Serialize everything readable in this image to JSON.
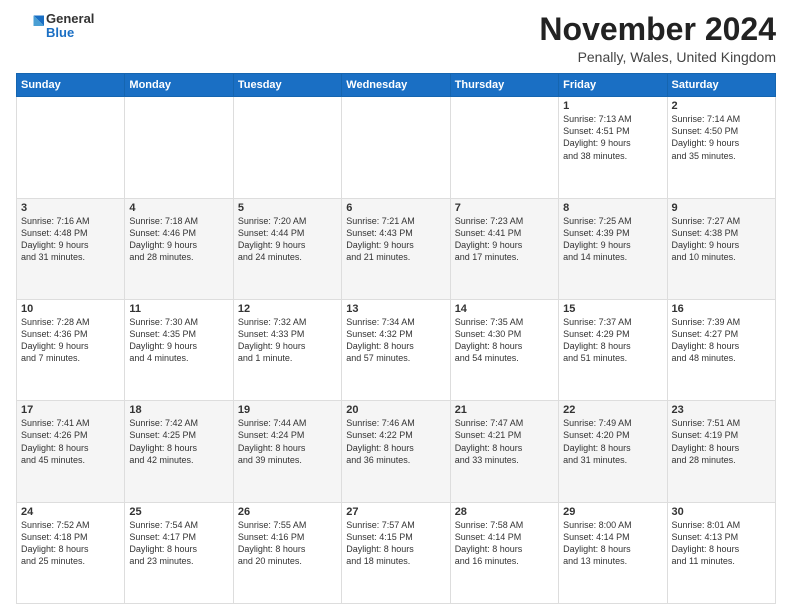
{
  "header": {
    "logo_general": "General",
    "logo_blue": "Blue",
    "month": "November 2024",
    "location": "Penally, Wales, United Kingdom"
  },
  "weekdays": [
    "Sunday",
    "Monday",
    "Tuesday",
    "Wednesday",
    "Thursday",
    "Friday",
    "Saturday"
  ],
  "weeks": [
    [
      {
        "day": "",
        "info": ""
      },
      {
        "day": "",
        "info": ""
      },
      {
        "day": "",
        "info": ""
      },
      {
        "day": "",
        "info": ""
      },
      {
        "day": "",
        "info": ""
      },
      {
        "day": "1",
        "info": "Sunrise: 7:13 AM\nSunset: 4:51 PM\nDaylight: 9 hours\nand 38 minutes."
      },
      {
        "day": "2",
        "info": "Sunrise: 7:14 AM\nSunset: 4:50 PM\nDaylight: 9 hours\nand 35 minutes."
      }
    ],
    [
      {
        "day": "3",
        "info": "Sunrise: 7:16 AM\nSunset: 4:48 PM\nDaylight: 9 hours\nand 31 minutes."
      },
      {
        "day": "4",
        "info": "Sunrise: 7:18 AM\nSunset: 4:46 PM\nDaylight: 9 hours\nand 28 minutes."
      },
      {
        "day": "5",
        "info": "Sunrise: 7:20 AM\nSunset: 4:44 PM\nDaylight: 9 hours\nand 24 minutes."
      },
      {
        "day": "6",
        "info": "Sunrise: 7:21 AM\nSunset: 4:43 PM\nDaylight: 9 hours\nand 21 minutes."
      },
      {
        "day": "7",
        "info": "Sunrise: 7:23 AM\nSunset: 4:41 PM\nDaylight: 9 hours\nand 17 minutes."
      },
      {
        "day": "8",
        "info": "Sunrise: 7:25 AM\nSunset: 4:39 PM\nDaylight: 9 hours\nand 14 minutes."
      },
      {
        "day": "9",
        "info": "Sunrise: 7:27 AM\nSunset: 4:38 PM\nDaylight: 9 hours\nand 10 minutes."
      }
    ],
    [
      {
        "day": "10",
        "info": "Sunrise: 7:28 AM\nSunset: 4:36 PM\nDaylight: 9 hours\nand 7 minutes."
      },
      {
        "day": "11",
        "info": "Sunrise: 7:30 AM\nSunset: 4:35 PM\nDaylight: 9 hours\nand 4 minutes."
      },
      {
        "day": "12",
        "info": "Sunrise: 7:32 AM\nSunset: 4:33 PM\nDaylight: 9 hours\nand 1 minute."
      },
      {
        "day": "13",
        "info": "Sunrise: 7:34 AM\nSunset: 4:32 PM\nDaylight: 8 hours\nand 57 minutes."
      },
      {
        "day": "14",
        "info": "Sunrise: 7:35 AM\nSunset: 4:30 PM\nDaylight: 8 hours\nand 54 minutes."
      },
      {
        "day": "15",
        "info": "Sunrise: 7:37 AM\nSunset: 4:29 PM\nDaylight: 8 hours\nand 51 minutes."
      },
      {
        "day": "16",
        "info": "Sunrise: 7:39 AM\nSunset: 4:27 PM\nDaylight: 8 hours\nand 48 minutes."
      }
    ],
    [
      {
        "day": "17",
        "info": "Sunrise: 7:41 AM\nSunset: 4:26 PM\nDaylight: 8 hours\nand 45 minutes."
      },
      {
        "day": "18",
        "info": "Sunrise: 7:42 AM\nSunset: 4:25 PM\nDaylight: 8 hours\nand 42 minutes."
      },
      {
        "day": "19",
        "info": "Sunrise: 7:44 AM\nSunset: 4:24 PM\nDaylight: 8 hours\nand 39 minutes."
      },
      {
        "day": "20",
        "info": "Sunrise: 7:46 AM\nSunset: 4:22 PM\nDaylight: 8 hours\nand 36 minutes."
      },
      {
        "day": "21",
        "info": "Sunrise: 7:47 AM\nSunset: 4:21 PM\nDaylight: 8 hours\nand 33 minutes."
      },
      {
        "day": "22",
        "info": "Sunrise: 7:49 AM\nSunset: 4:20 PM\nDaylight: 8 hours\nand 31 minutes."
      },
      {
        "day": "23",
        "info": "Sunrise: 7:51 AM\nSunset: 4:19 PM\nDaylight: 8 hours\nand 28 minutes."
      }
    ],
    [
      {
        "day": "24",
        "info": "Sunrise: 7:52 AM\nSunset: 4:18 PM\nDaylight: 8 hours\nand 25 minutes."
      },
      {
        "day": "25",
        "info": "Sunrise: 7:54 AM\nSunset: 4:17 PM\nDaylight: 8 hours\nand 23 minutes."
      },
      {
        "day": "26",
        "info": "Sunrise: 7:55 AM\nSunset: 4:16 PM\nDaylight: 8 hours\nand 20 minutes."
      },
      {
        "day": "27",
        "info": "Sunrise: 7:57 AM\nSunset: 4:15 PM\nDaylight: 8 hours\nand 18 minutes."
      },
      {
        "day": "28",
        "info": "Sunrise: 7:58 AM\nSunset: 4:14 PM\nDaylight: 8 hours\nand 16 minutes."
      },
      {
        "day": "29",
        "info": "Sunrise: 8:00 AM\nSunset: 4:14 PM\nDaylight: 8 hours\nand 13 minutes."
      },
      {
        "day": "30",
        "info": "Sunrise: 8:01 AM\nSunset: 4:13 PM\nDaylight: 8 hours\nand 11 minutes."
      }
    ]
  ]
}
